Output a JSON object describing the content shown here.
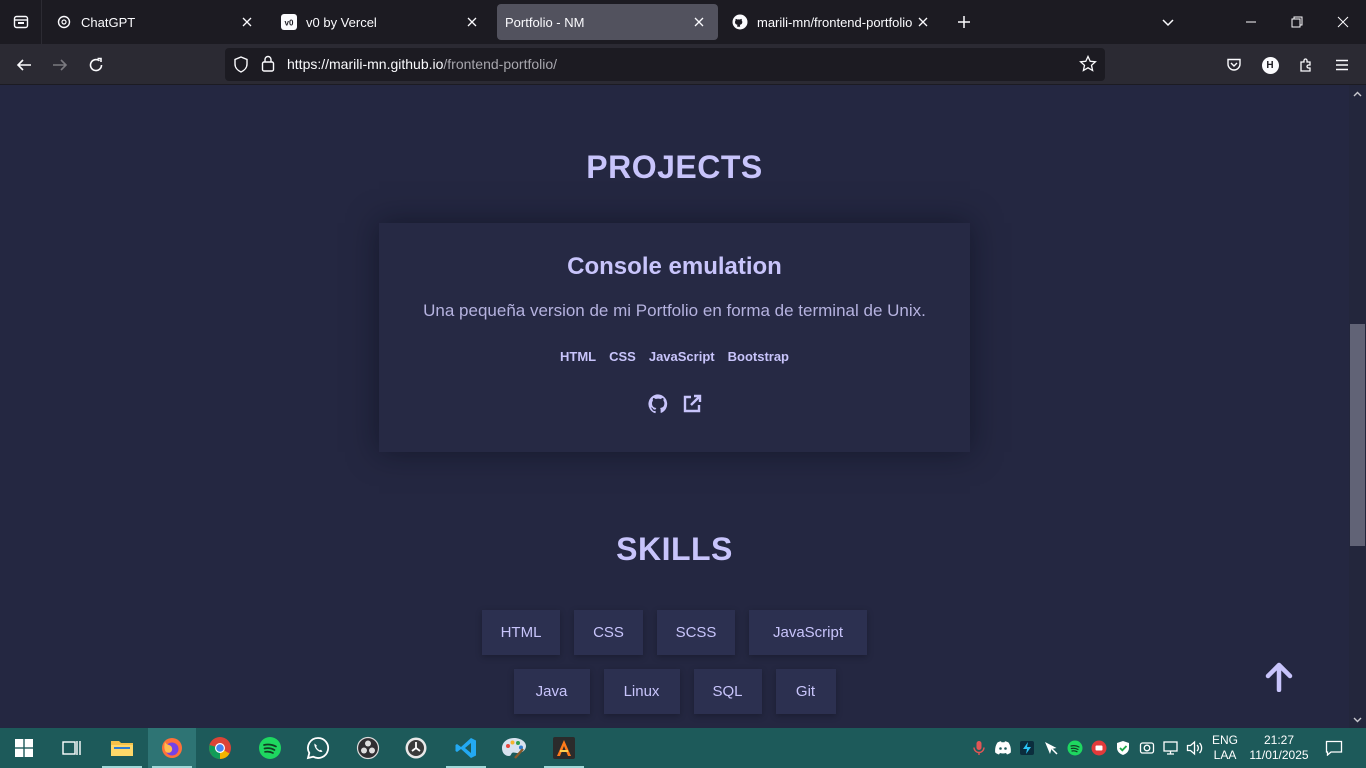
{
  "browser": {
    "tabs": [
      {
        "title": "ChatGPT",
        "icon": "chatgpt-icon",
        "active": false
      },
      {
        "title": "v0 by Vercel",
        "icon": "v0-icon",
        "active": false
      },
      {
        "title": "Portfolio - NM",
        "icon": "none",
        "active": true
      },
      {
        "title": "marili-mn/frontend-portfolio",
        "icon": "github-icon",
        "active": false
      }
    ],
    "url_host": "https://marili-mn.github.io",
    "url_path": "/frontend-portfolio/",
    "profile_initial": "H"
  },
  "page": {
    "projects_heading": "PROJECTS",
    "project": {
      "title": "Console emulation",
      "description": "Una pequeña version de mi Portfolio en forma de terminal de Unix.",
      "tags": [
        "HTML",
        "CSS",
        "JavaScript",
        "Bootstrap"
      ]
    },
    "skills_heading": "SKILLS",
    "skills_row1": [
      "HTML",
      "CSS",
      "SCSS",
      "JavaScript"
    ],
    "skills_row2": [
      "Java",
      "Linux",
      "SQL",
      "Git"
    ]
  },
  "taskbar": {
    "apps": [
      "start-icon",
      "task-view-icon",
      "file-explorer-icon",
      "firefox-icon",
      "chrome-icon",
      "spotify-icon",
      "whatsapp-icon",
      "obs-icon",
      "clock-app-icon",
      "vscode-icon",
      "paint-icon",
      "terminal-app-icon"
    ],
    "lang_top": "ENG",
    "lang_bottom": "LAA",
    "time": "21:27",
    "date": "11/01/2025"
  },
  "colors": {
    "page_bg": "#242741",
    "accent": "#c8c4fb",
    "card_bg": "#262944",
    "skill_bg": "#2c3050",
    "taskbar_bg": "#1d5a5a"
  }
}
